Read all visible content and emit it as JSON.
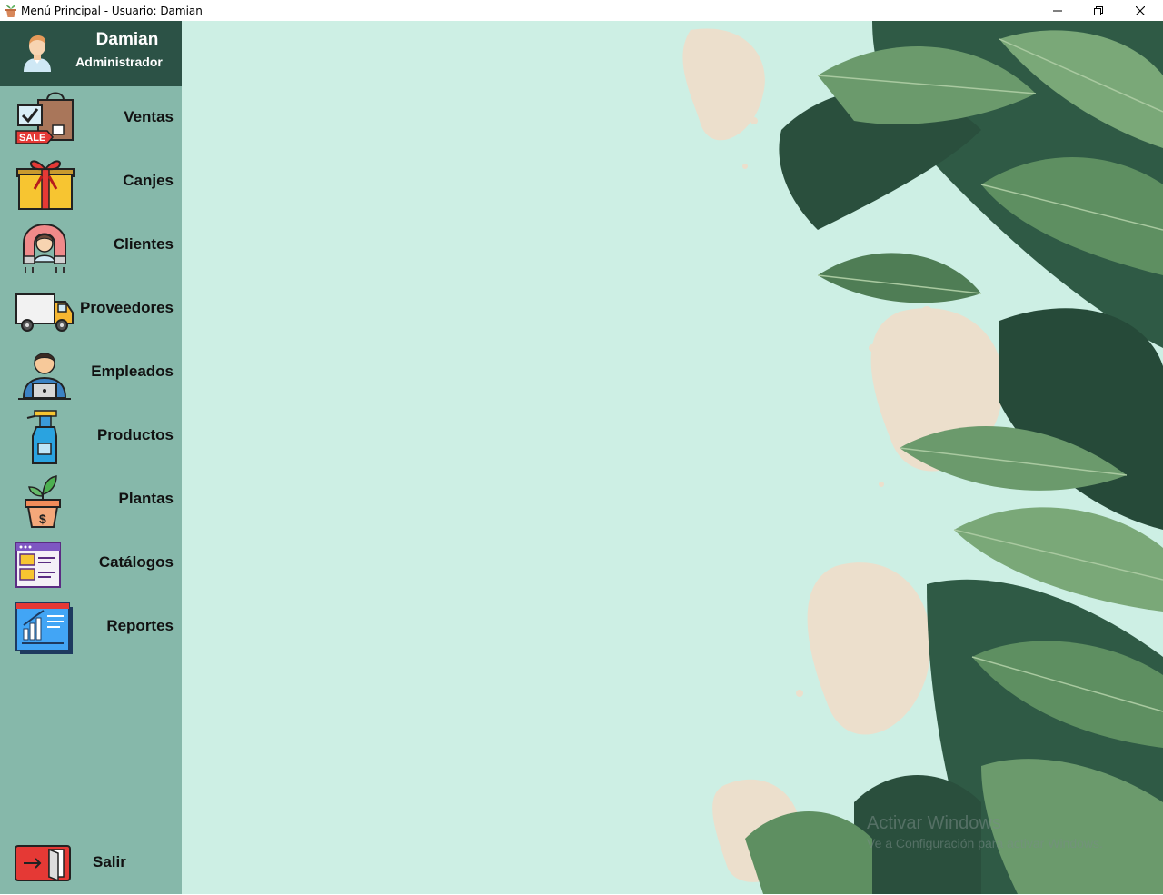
{
  "window": {
    "title": "Menú Principal - Usuario: Damian"
  },
  "user": {
    "name": "Damian",
    "role": "Administrador"
  },
  "nav": [
    {
      "label": "Ventas",
      "icon": "shopping-bag-sale-icon"
    },
    {
      "label": "Canjes",
      "icon": "gift-box-icon"
    },
    {
      "label": "Clientes",
      "icon": "customer-magnet-icon"
    },
    {
      "label": "Proveedores",
      "icon": "delivery-truck-icon"
    },
    {
      "label": "Empleados",
      "icon": "employee-laptop-icon"
    },
    {
      "label": "Productos",
      "icon": "spray-bottle-icon"
    },
    {
      "label": "Plantas",
      "icon": "plant-pot-icon"
    },
    {
      "label": "Catálogos",
      "icon": "catalog-window-icon"
    },
    {
      "label": "Reportes",
      "icon": "report-chart-icon"
    }
  ],
  "exit": {
    "label": "Salir",
    "icon": "exit-door-icon"
  },
  "watermark": {
    "line1": "Activar Windows",
    "line2": "Ve a Configuración para activar Windows."
  },
  "colors": {
    "sidebar": "#86b8aa",
    "user_header": "#2c5246",
    "main_bg": "#cdefe4",
    "leaf_dark": "#2f5a45",
    "leaf_light": "#6b9a6c",
    "blob": "#ecdfcc"
  }
}
